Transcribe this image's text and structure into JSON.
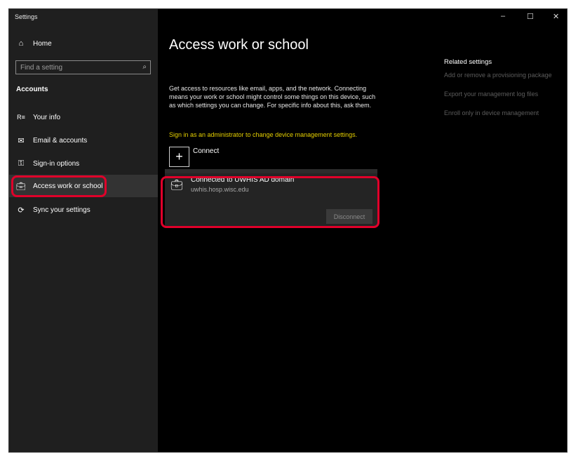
{
  "window": {
    "title": "Settings",
    "controls": {
      "minimize": "–",
      "maximize": "☐",
      "close": "✕"
    }
  },
  "sidebar": {
    "home": {
      "icon": "home-icon",
      "label": "Home"
    },
    "search": {
      "placeholder": "Find a setting",
      "icon": "search-icon"
    },
    "section_title": "Accounts",
    "items": [
      {
        "icon": "person-list-icon",
        "label": "Your info"
      },
      {
        "icon": "mail-icon",
        "label": "Email & accounts"
      },
      {
        "icon": "key-icon",
        "label": "Sign-in options"
      },
      {
        "icon": "briefcase-icon",
        "label": "Access work or school"
      },
      {
        "icon": "sync-icon",
        "label": "Sync your settings"
      }
    ],
    "selected_index": 3
  },
  "main": {
    "title": "Access work or school",
    "description": "Get access to resources like email, apps, and the network. Connecting means your work or school might control some things on this device, such as which settings you can change. For specific info about this, ask them.",
    "admin_link": "Sign in as an administrator to change device management settings.",
    "connect": {
      "icon": "plus-icon",
      "label": "Connect"
    },
    "connection": {
      "icon": "briefcase-icon",
      "title": "Connected to UWHIS AD domain",
      "domain": "uwhis.hosp.wisc.edu",
      "disconnect_label": "Disconnect"
    }
  },
  "related": {
    "heading": "Related settings",
    "links": [
      "Add or remove a provisioning package",
      "Export your management log files",
      "Enroll only in device management"
    ]
  },
  "colors": {
    "annotation": "#e0002a",
    "admin_link": "#e6d000",
    "sidebar_bg": "#1f1f1f",
    "selected_bg": "#333333"
  }
}
